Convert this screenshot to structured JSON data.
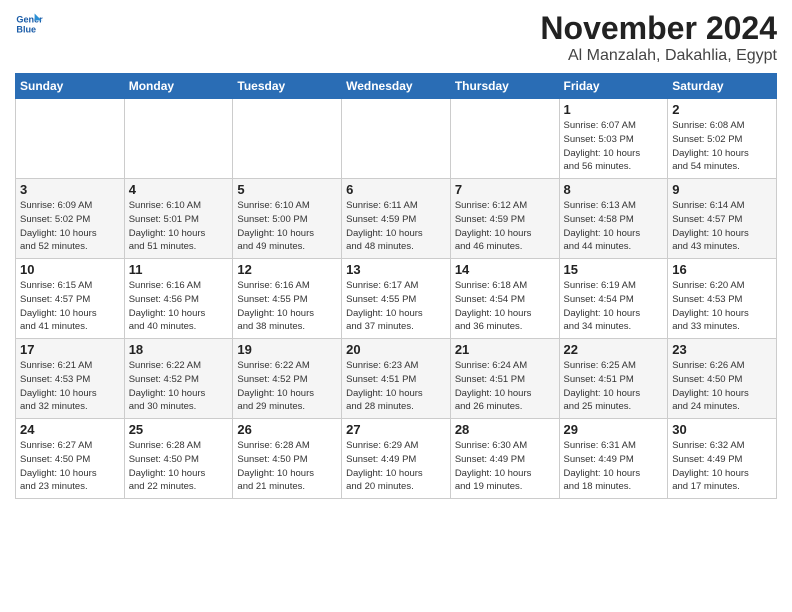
{
  "header": {
    "logo_line1": "General",
    "logo_line2": "Blue",
    "month": "November 2024",
    "location": "Al Manzalah, Dakahlia, Egypt"
  },
  "weekdays": [
    "Sunday",
    "Monday",
    "Tuesday",
    "Wednesday",
    "Thursday",
    "Friday",
    "Saturday"
  ],
  "rows": [
    [
      {
        "day": "",
        "info": ""
      },
      {
        "day": "",
        "info": ""
      },
      {
        "day": "",
        "info": ""
      },
      {
        "day": "",
        "info": ""
      },
      {
        "day": "",
        "info": ""
      },
      {
        "day": "1",
        "info": "Sunrise: 6:07 AM\nSunset: 5:03 PM\nDaylight: 10 hours\nand 56 minutes."
      },
      {
        "day": "2",
        "info": "Sunrise: 6:08 AM\nSunset: 5:02 PM\nDaylight: 10 hours\nand 54 minutes."
      }
    ],
    [
      {
        "day": "3",
        "info": "Sunrise: 6:09 AM\nSunset: 5:02 PM\nDaylight: 10 hours\nand 52 minutes."
      },
      {
        "day": "4",
        "info": "Sunrise: 6:10 AM\nSunset: 5:01 PM\nDaylight: 10 hours\nand 51 minutes."
      },
      {
        "day": "5",
        "info": "Sunrise: 6:10 AM\nSunset: 5:00 PM\nDaylight: 10 hours\nand 49 minutes."
      },
      {
        "day": "6",
        "info": "Sunrise: 6:11 AM\nSunset: 4:59 PM\nDaylight: 10 hours\nand 48 minutes."
      },
      {
        "day": "7",
        "info": "Sunrise: 6:12 AM\nSunset: 4:59 PM\nDaylight: 10 hours\nand 46 minutes."
      },
      {
        "day": "8",
        "info": "Sunrise: 6:13 AM\nSunset: 4:58 PM\nDaylight: 10 hours\nand 44 minutes."
      },
      {
        "day": "9",
        "info": "Sunrise: 6:14 AM\nSunset: 4:57 PM\nDaylight: 10 hours\nand 43 minutes."
      }
    ],
    [
      {
        "day": "10",
        "info": "Sunrise: 6:15 AM\nSunset: 4:57 PM\nDaylight: 10 hours\nand 41 minutes."
      },
      {
        "day": "11",
        "info": "Sunrise: 6:16 AM\nSunset: 4:56 PM\nDaylight: 10 hours\nand 40 minutes."
      },
      {
        "day": "12",
        "info": "Sunrise: 6:16 AM\nSunset: 4:55 PM\nDaylight: 10 hours\nand 38 minutes."
      },
      {
        "day": "13",
        "info": "Sunrise: 6:17 AM\nSunset: 4:55 PM\nDaylight: 10 hours\nand 37 minutes."
      },
      {
        "day": "14",
        "info": "Sunrise: 6:18 AM\nSunset: 4:54 PM\nDaylight: 10 hours\nand 36 minutes."
      },
      {
        "day": "15",
        "info": "Sunrise: 6:19 AM\nSunset: 4:54 PM\nDaylight: 10 hours\nand 34 minutes."
      },
      {
        "day": "16",
        "info": "Sunrise: 6:20 AM\nSunset: 4:53 PM\nDaylight: 10 hours\nand 33 minutes."
      }
    ],
    [
      {
        "day": "17",
        "info": "Sunrise: 6:21 AM\nSunset: 4:53 PM\nDaylight: 10 hours\nand 32 minutes."
      },
      {
        "day": "18",
        "info": "Sunrise: 6:22 AM\nSunset: 4:52 PM\nDaylight: 10 hours\nand 30 minutes."
      },
      {
        "day": "19",
        "info": "Sunrise: 6:22 AM\nSunset: 4:52 PM\nDaylight: 10 hours\nand 29 minutes."
      },
      {
        "day": "20",
        "info": "Sunrise: 6:23 AM\nSunset: 4:51 PM\nDaylight: 10 hours\nand 28 minutes."
      },
      {
        "day": "21",
        "info": "Sunrise: 6:24 AM\nSunset: 4:51 PM\nDaylight: 10 hours\nand 26 minutes."
      },
      {
        "day": "22",
        "info": "Sunrise: 6:25 AM\nSunset: 4:51 PM\nDaylight: 10 hours\nand 25 minutes."
      },
      {
        "day": "23",
        "info": "Sunrise: 6:26 AM\nSunset: 4:50 PM\nDaylight: 10 hours\nand 24 minutes."
      }
    ],
    [
      {
        "day": "24",
        "info": "Sunrise: 6:27 AM\nSunset: 4:50 PM\nDaylight: 10 hours\nand 23 minutes."
      },
      {
        "day": "25",
        "info": "Sunrise: 6:28 AM\nSunset: 4:50 PM\nDaylight: 10 hours\nand 22 minutes."
      },
      {
        "day": "26",
        "info": "Sunrise: 6:28 AM\nSunset: 4:50 PM\nDaylight: 10 hours\nand 21 minutes."
      },
      {
        "day": "27",
        "info": "Sunrise: 6:29 AM\nSunset: 4:49 PM\nDaylight: 10 hours\nand 20 minutes."
      },
      {
        "day": "28",
        "info": "Sunrise: 6:30 AM\nSunset: 4:49 PM\nDaylight: 10 hours\nand 19 minutes."
      },
      {
        "day": "29",
        "info": "Sunrise: 6:31 AM\nSunset: 4:49 PM\nDaylight: 10 hours\nand 18 minutes."
      },
      {
        "day": "30",
        "info": "Sunrise: 6:32 AM\nSunset: 4:49 PM\nDaylight: 10 hours\nand 17 minutes."
      }
    ]
  ]
}
